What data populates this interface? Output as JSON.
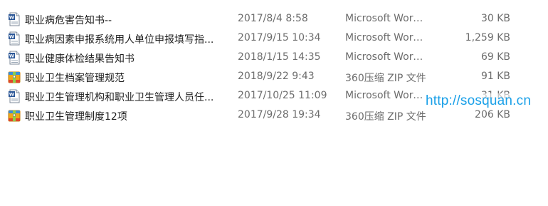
{
  "files": [
    {
      "icon": "word-doc-icon",
      "name": "职业病危害告知书--",
      "date": "2017/8/4 8:58",
      "type": "Microsoft Word ...",
      "size": "30 KB"
    },
    {
      "icon": "word-doc-icon",
      "name": "职业病因素申报系统用人单位申报填写指...",
      "date": "2017/9/15 10:34",
      "type": "Microsoft Word ...",
      "size": "1,259 KB"
    },
    {
      "icon": "word-doc-icon",
      "name": "职业健康体检结果告知书",
      "date": "2018/1/15 14:35",
      "type": "Microsoft Word ...",
      "size": "69 KB"
    },
    {
      "icon": "zip-archive-icon",
      "name": "职业卫生档案管理规范",
      "date": "2018/9/22 9:43",
      "type": "360压缩 ZIP 文件",
      "size": "91 KB"
    },
    {
      "icon": "word-doc-icon",
      "name": "职业卫生管理机构和职业卫生管理人员任...",
      "date": "2017/10/25 11:09",
      "type": "Microsoft Word ...",
      "size": "31 KB"
    },
    {
      "icon": "zip-archive-icon",
      "name": "职业卫生管理制度12项",
      "date": "2017/9/28 19:34",
      "type": "360压缩 ZIP 文件",
      "size": "206 KB"
    }
  ],
  "watermark": "http://sosquan.cn"
}
